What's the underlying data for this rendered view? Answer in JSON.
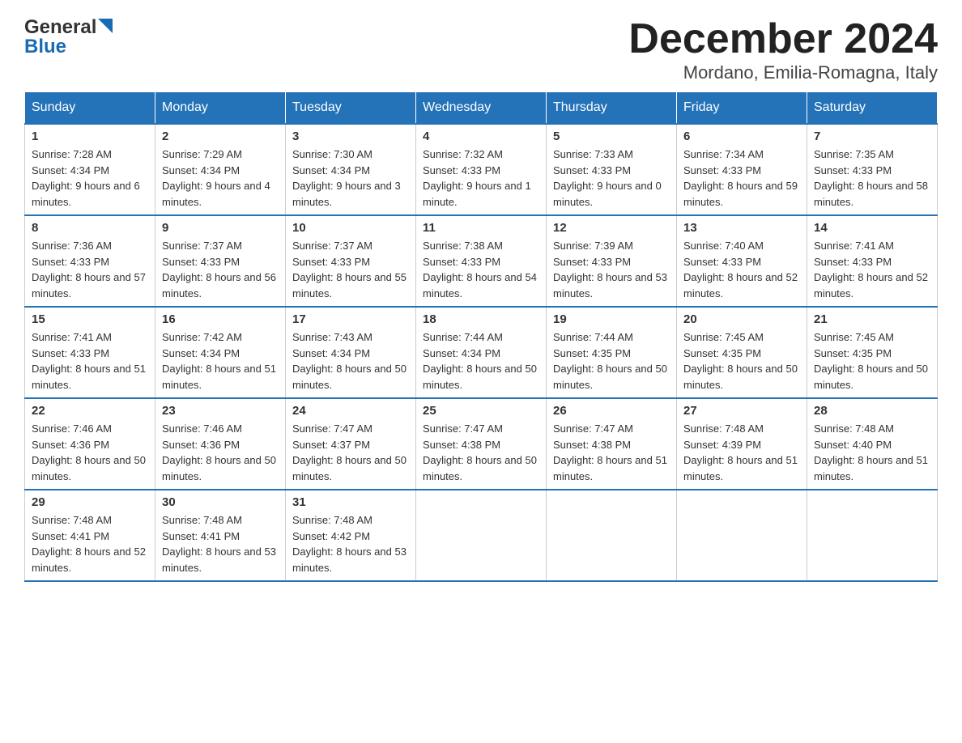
{
  "header": {
    "title": "December 2024",
    "subtitle": "Mordano, Emilia-Romagna, Italy",
    "logo_line1": "General",
    "logo_line2": "Blue"
  },
  "days_of_week": [
    "Sunday",
    "Monday",
    "Tuesday",
    "Wednesday",
    "Thursday",
    "Friday",
    "Saturday"
  ],
  "weeks": [
    [
      {
        "day": "1",
        "sunrise": "7:28 AM",
        "sunset": "4:34 PM",
        "daylight": "9 hours and 6 minutes."
      },
      {
        "day": "2",
        "sunrise": "7:29 AM",
        "sunset": "4:34 PM",
        "daylight": "9 hours and 4 minutes."
      },
      {
        "day": "3",
        "sunrise": "7:30 AM",
        "sunset": "4:34 PM",
        "daylight": "9 hours and 3 minutes."
      },
      {
        "day": "4",
        "sunrise": "7:32 AM",
        "sunset": "4:33 PM",
        "daylight": "9 hours and 1 minute."
      },
      {
        "day": "5",
        "sunrise": "7:33 AM",
        "sunset": "4:33 PM",
        "daylight": "9 hours and 0 minutes."
      },
      {
        "day": "6",
        "sunrise": "7:34 AM",
        "sunset": "4:33 PM",
        "daylight": "8 hours and 59 minutes."
      },
      {
        "day": "7",
        "sunrise": "7:35 AM",
        "sunset": "4:33 PM",
        "daylight": "8 hours and 58 minutes."
      }
    ],
    [
      {
        "day": "8",
        "sunrise": "7:36 AM",
        "sunset": "4:33 PM",
        "daylight": "8 hours and 57 minutes."
      },
      {
        "day": "9",
        "sunrise": "7:37 AM",
        "sunset": "4:33 PM",
        "daylight": "8 hours and 56 minutes."
      },
      {
        "day": "10",
        "sunrise": "7:37 AM",
        "sunset": "4:33 PM",
        "daylight": "8 hours and 55 minutes."
      },
      {
        "day": "11",
        "sunrise": "7:38 AM",
        "sunset": "4:33 PM",
        "daylight": "8 hours and 54 minutes."
      },
      {
        "day": "12",
        "sunrise": "7:39 AM",
        "sunset": "4:33 PM",
        "daylight": "8 hours and 53 minutes."
      },
      {
        "day": "13",
        "sunrise": "7:40 AM",
        "sunset": "4:33 PM",
        "daylight": "8 hours and 52 minutes."
      },
      {
        "day": "14",
        "sunrise": "7:41 AM",
        "sunset": "4:33 PM",
        "daylight": "8 hours and 52 minutes."
      }
    ],
    [
      {
        "day": "15",
        "sunrise": "7:41 AM",
        "sunset": "4:33 PM",
        "daylight": "8 hours and 51 minutes."
      },
      {
        "day": "16",
        "sunrise": "7:42 AM",
        "sunset": "4:34 PM",
        "daylight": "8 hours and 51 minutes."
      },
      {
        "day": "17",
        "sunrise": "7:43 AM",
        "sunset": "4:34 PM",
        "daylight": "8 hours and 50 minutes."
      },
      {
        "day": "18",
        "sunrise": "7:44 AM",
        "sunset": "4:34 PM",
        "daylight": "8 hours and 50 minutes."
      },
      {
        "day": "19",
        "sunrise": "7:44 AM",
        "sunset": "4:35 PM",
        "daylight": "8 hours and 50 minutes."
      },
      {
        "day": "20",
        "sunrise": "7:45 AM",
        "sunset": "4:35 PM",
        "daylight": "8 hours and 50 minutes."
      },
      {
        "day": "21",
        "sunrise": "7:45 AM",
        "sunset": "4:35 PM",
        "daylight": "8 hours and 50 minutes."
      }
    ],
    [
      {
        "day": "22",
        "sunrise": "7:46 AM",
        "sunset": "4:36 PM",
        "daylight": "8 hours and 50 minutes."
      },
      {
        "day": "23",
        "sunrise": "7:46 AM",
        "sunset": "4:36 PM",
        "daylight": "8 hours and 50 minutes."
      },
      {
        "day": "24",
        "sunrise": "7:47 AM",
        "sunset": "4:37 PM",
        "daylight": "8 hours and 50 minutes."
      },
      {
        "day": "25",
        "sunrise": "7:47 AM",
        "sunset": "4:38 PM",
        "daylight": "8 hours and 50 minutes."
      },
      {
        "day": "26",
        "sunrise": "7:47 AM",
        "sunset": "4:38 PM",
        "daylight": "8 hours and 51 minutes."
      },
      {
        "day": "27",
        "sunrise": "7:48 AM",
        "sunset": "4:39 PM",
        "daylight": "8 hours and 51 minutes."
      },
      {
        "day": "28",
        "sunrise": "7:48 AM",
        "sunset": "4:40 PM",
        "daylight": "8 hours and 51 minutes."
      }
    ],
    [
      {
        "day": "29",
        "sunrise": "7:48 AM",
        "sunset": "4:41 PM",
        "daylight": "8 hours and 52 minutes."
      },
      {
        "day": "30",
        "sunrise": "7:48 AM",
        "sunset": "4:41 PM",
        "daylight": "8 hours and 53 minutes."
      },
      {
        "day": "31",
        "sunrise": "7:48 AM",
        "sunset": "4:42 PM",
        "daylight": "8 hours and 53 minutes."
      },
      null,
      null,
      null,
      null
    ]
  ]
}
